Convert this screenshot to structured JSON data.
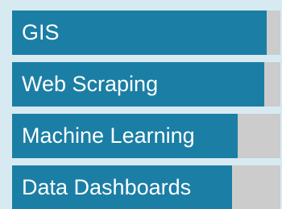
{
  "skills": [
    {
      "label": "GIS",
      "level": 0.95
    },
    {
      "label": "Web Scraping",
      "level": 0.94
    },
    {
      "label": "Machine Learning",
      "level": 0.84
    },
    {
      "label": "Data Dashboards",
      "level": 0.82
    }
  ],
  "colors": {
    "background": "#d7eaf1",
    "fill": "#1b7ea5",
    "track": "#cccccc",
    "text": "#ffffff"
  }
}
